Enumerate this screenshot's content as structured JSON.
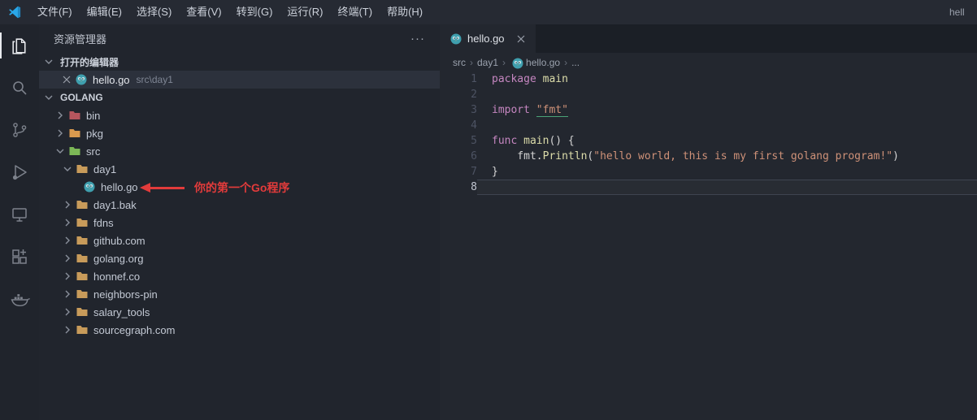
{
  "title_bar": {
    "window_title": "hell",
    "menus": [
      {
        "name": "file",
        "label": "文件(F)"
      },
      {
        "name": "edit",
        "label": "编辑(E)"
      },
      {
        "name": "selection",
        "label": "选择(S)"
      },
      {
        "name": "view",
        "label": "查看(V)"
      },
      {
        "name": "goto",
        "label": "转到(G)"
      },
      {
        "name": "run",
        "label": "运行(R)"
      },
      {
        "name": "terminal",
        "label": "终端(T)"
      },
      {
        "name": "help",
        "label": "帮助(H)"
      }
    ]
  },
  "activity_bar": {
    "items": [
      {
        "name": "explorer",
        "icon": "explorer",
        "active": true
      },
      {
        "name": "search",
        "icon": "search",
        "active": false
      },
      {
        "name": "source-control",
        "icon": "source-control",
        "active": false
      },
      {
        "name": "run-and-debug",
        "icon": "run-debug",
        "active": false
      },
      {
        "name": "remote-explorer",
        "icon": "remote-explorer",
        "active": false
      },
      {
        "name": "extensions",
        "icon": "extensions",
        "active": false
      },
      {
        "name": "docker",
        "icon": "docker",
        "active": false
      }
    ]
  },
  "sidebar": {
    "title": "资源管理器",
    "more_label": "···",
    "open_editors": {
      "label": "打开的编辑器",
      "items": [
        {
          "file": "hello.go",
          "detail": "src\\day1",
          "icon": "go"
        }
      ]
    },
    "project": {
      "label": "GOLANG",
      "tree": [
        {
          "label": "bin",
          "depth": 0,
          "chevron": "collapsed",
          "icon": "folder",
          "color": "#b5565e"
        },
        {
          "label": "pkg",
          "depth": 0,
          "chevron": "collapsed",
          "icon": "folder",
          "color": "#d9994e"
        },
        {
          "label": "src",
          "depth": 0,
          "chevron": "expanded",
          "icon": "folder",
          "color": "#7cb857"
        },
        {
          "label": "day1",
          "depth": 1,
          "chevron": "expanded",
          "icon": "folder",
          "color": "#c89b5a"
        },
        {
          "label": "hello.go",
          "depth": 2,
          "chevron": "none",
          "icon": "go"
        },
        {
          "label": "day1.bak",
          "depth": 1,
          "chevron": "collapsed",
          "icon": "folder",
          "color": "#c89b5a"
        },
        {
          "label": "fdns",
          "depth": 1,
          "chevron": "collapsed",
          "icon": "folder",
          "color": "#c89b5a"
        },
        {
          "label": "github.com",
          "depth": 1,
          "chevron": "collapsed",
          "icon": "folder",
          "color": "#c89b5a"
        },
        {
          "label": "golang.org",
          "depth": 1,
          "chevron": "collapsed",
          "icon": "folder",
          "color": "#c89b5a"
        },
        {
          "label": "honnef.co",
          "depth": 1,
          "chevron": "collapsed",
          "icon": "folder",
          "color": "#c89b5a"
        },
        {
          "label": "neighbors-pin",
          "depth": 1,
          "chevron": "collapsed",
          "icon": "folder",
          "color": "#c89b5a"
        },
        {
          "label": "salary_tools",
          "depth": 1,
          "chevron": "collapsed",
          "icon": "folder",
          "color": "#c89b5a"
        },
        {
          "label": "sourcegraph.com",
          "depth": 1,
          "chevron": "collapsed",
          "icon": "folder",
          "color": "#c89b5a"
        }
      ]
    }
  },
  "annotation": {
    "text": "你的第一个Go程序",
    "color": "#e23b3b"
  },
  "editor": {
    "tab": {
      "label": "hello.go",
      "icon": "go"
    },
    "breadcrumbs": [
      {
        "label": "src"
      },
      {
        "label": "day1"
      },
      {
        "label": "hello.go",
        "icon": "go"
      },
      {
        "label": "..."
      }
    ],
    "code_lines": [
      {
        "n": "1",
        "tokens": [
          {
            "t": "package ",
            "c": "kw"
          },
          {
            "t": "main",
            "c": "fn"
          }
        ]
      },
      {
        "n": "2",
        "tokens": []
      },
      {
        "n": "3",
        "tokens": [
          {
            "t": "import ",
            "c": "kw"
          },
          {
            "t": "\"fmt\"",
            "c": "str",
            "u": true
          }
        ]
      },
      {
        "n": "4",
        "tokens": []
      },
      {
        "n": "5",
        "tokens": [
          {
            "t": "func ",
            "c": "kw"
          },
          {
            "t": "main",
            "c": "fn"
          },
          {
            "t": "() {",
            "c": "pl"
          }
        ]
      },
      {
        "n": "6",
        "tokens": [
          {
            "t": "    fmt.",
            "c": "pl"
          },
          {
            "t": "Println",
            "c": "fn"
          },
          {
            "t": "(",
            "c": "pl"
          },
          {
            "t": "\"hello world, this is my first golang program!\"",
            "c": "str"
          },
          {
            "t": ")",
            "c": "pl"
          }
        ]
      },
      {
        "n": "7",
        "tokens": [
          {
            "t": "}",
            "c": "pl"
          }
        ]
      },
      {
        "n": "8",
        "tokens": [],
        "current": true
      }
    ]
  }
}
